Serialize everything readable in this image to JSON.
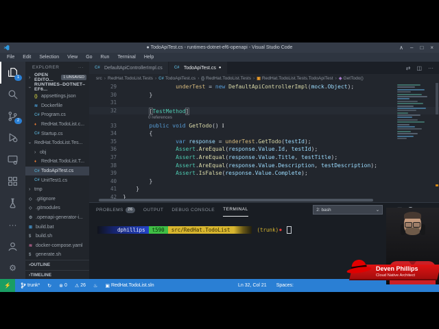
{
  "window": {
    "title": "● TodoApiTest.cs - runtimes-dotnet-ef6-openapi - Visual Studio Code",
    "controls": [
      "∧",
      "–",
      "□",
      "×"
    ]
  },
  "menu": {
    "items": [
      "File",
      "Edit",
      "Selection",
      "View",
      "Go",
      "Run",
      "Terminal",
      "Help"
    ]
  },
  "activity_bar": {
    "items": [
      {
        "name": "explorer",
        "badge": "1",
        "active": true
      },
      {
        "name": "search"
      },
      {
        "name": "source-control",
        "badge": "2"
      },
      {
        "name": "run-debug"
      },
      {
        "name": "remote-explorer"
      },
      {
        "name": "extensions"
      },
      {
        "name": "testing"
      },
      {
        "name": "more",
        "glyph": "···"
      },
      {
        "name": "account"
      },
      {
        "name": "settings",
        "glyph": "⚙"
      }
    ]
  },
  "sidebar": {
    "title": "EXPLORER",
    "title_actions": "···",
    "open_editors": {
      "label": "OPEN EDITO...",
      "badge": "1 UNSAVED"
    },
    "root": {
      "label": "RUNTIMES–DOTNET–EF6..."
    },
    "tree": [
      {
        "label": "appsettings.json",
        "icon": "json",
        "level": 1
      },
      {
        "label": "Dockerfile",
        "icon": "docker",
        "level": 1
      },
      {
        "label": "Program.cs",
        "icon": "cs",
        "level": 1
      },
      {
        "label": "RedHat.TodoList.c...",
        "icon": "flame",
        "level": 1
      },
      {
        "label": "Startup.cs",
        "icon": "cs",
        "level": 1
      },
      {
        "label": "RedHat.TodoList.Tes...",
        "level": 0,
        "chevron": "down"
      },
      {
        "label": "obj",
        "level": 1,
        "chevron": "right"
      },
      {
        "label": "RedHat.TodoList.T...",
        "icon": "flame",
        "level": 1
      },
      {
        "label": "TodoApiTest.cs",
        "icon": "cs",
        "level": 1,
        "selected": true
      },
      {
        "label": "UnitTest1.cs",
        "icon": "cs",
        "level": 1
      },
      {
        "label": "tmp",
        "level": 0,
        "chevron": "right"
      },
      {
        "label": ".gitignore",
        "icon": "diamond",
        "level": 0
      },
      {
        "label": ".gitmodules",
        "icon": "diamond",
        "level": 0
      },
      {
        "label": ".openapi-generator-i...",
        "icon": "gear",
        "level": 0
      },
      {
        "label": "build.bat",
        "icon": "win",
        "level": 0
      },
      {
        "label": "build.sh",
        "icon": "shell",
        "level": 0
      },
      {
        "label": "docker-compose.yaml",
        "icon": "compose",
        "level": 0
      },
      {
        "label": "generate.sh",
        "icon": "shell",
        "level": 0
      }
    ],
    "sections": [
      {
        "label": "OUTLINE"
      },
      {
        "label": "TIMELINE"
      }
    ]
  },
  "editor": {
    "tabs": [
      {
        "label": "DefaultApiControllerImpl.cs",
        "icon": "cs",
        "active": false,
        "dirty": false
      },
      {
        "label": "TodoApiTest.cs",
        "icon": "cs",
        "active": true,
        "dirty": true
      }
    ],
    "actions": [
      {
        "name": "open-changes",
        "glyph": "⇄"
      },
      {
        "name": "split-editor",
        "glyph": "◫"
      },
      {
        "name": "more-actions",
        "glyph": "···"
      }
    ],
    "breadcrumb": [
      {
        "label": "src"
      },
      {
        "label": "RedHat.TodoList.Tests"
      },
      {
        "label": "TodoApiTest.cs",
        "icon": "cs"
      },
      {
        "label": "RedHat.TodoList.Tests",
        "icon": "braces"
      },
      {
        "label": "RedHat.TodoList.Tests.TodoApiTest",
        "icon": "class"
      },
      {
        "label": "GetTodo()",
        "icon": "method"
      }
    ],
    "codelens": "0 references",
    "code_lines": [
      {
        "n": "29",
        "tokens": [
          [
            "                ",
            "pln"
          ],
          [
            "underTest",
            "field"
          ],
          [
            " = ",
            "pln"
          ],
          [
            "new",
            "kw"
          ],
          [
            " ",
            "pln"
          ],
          [
            "DefaultApiControllerImpl",
            "method"
          ],
          [
            "(",
            "pln"
          ],
          [
            "mock",
            "var"
          ],
          [
            ".",
            "pln"
          ],
          [
            "Object",
            "var"
          ],
          [
            ");",
            "pln"
          ]
        ]
      },
      {
        "n": "30",
        "tokens": [
          [
            "        ",
            "pln"
          ],
          [
            "}",
            "pln"
          ]
        ]
      },
      {
        "n": "31",
        "tokens": []
      },
      {
        "n": "32",
        "current": true,
        "cursor": true,
        "tokens": [
          [
            "        ",
            "pln"
          ],
          [
            "[",
            "bracket"
          ],
          [
            "TestMethod",
            "type"
          ],
          [
            "]",
            "bracket"
          ]
        ]
      },
      {
        "n": "",
        "codelens": true
      },
      {
        "n": "33",
        "ibeam": true,
        "tokens": [
          [
            "        ",
            "pln"
          ],
          [
            "public",
            "kw"
          ],
          [
            " ",
            "pln"
          ],
          [
            "void",
            "kw"
          ],
          [
            " ",
            "pln"
          ],
          [
            "GetTodo",
            "method"
          ],
          [
            "()",
            "pln"
          ]
        ]
      },
      {
        "n": "34",
        "tokens": [
          [
            "        ",
            "pln"
          ],
          [
            "{",
            "pln"
          ]
        ]
      },
      {
        "n": "35",
        "tokens": [
          [
            "                ",
            "pln"
          ],
          [
            "var",
            "kw"
          ],
          [
            " ",
            "pln"
          ],
          [
            "response",
            "var"
          ],
          [
            " = ",
            "pln"
          ],
          [
            "underTest",
            "field"
          ],
          [
            ".",
            "pln"
          ],
          [
            "GetTodo",
            "method"
          ],
          [
            "(",
            "pln"
          ],
          [
            "testId",
            "var"
          ],
          [
            ");",
            "pln"
          ]
        ]
      },
      {
        "n": "36",
        "tokens": [
          [
            "                ",
            "pln"
          ],
          [
            "Assert",
            "type"
          ],
          [
            ".",
            "pln"
          ],
          [
            "AreEqual",
            "method"
          ],
          [
            "(",
            "pln"
          ],
          [
            "response",
            "var"
          ],
          [
            ".",
            "pln"
          ],
          [
            "Value",
            "var"
          ],
          [
            ".",
            "pln"
          ],
          [
            "Id",
            "var"
          ],
          [
            ", ",
            "pln"
          ],
          [
            "testId",
            "var"
          ],
          [
            ");",
            "pln"
          ]
        ]
      },
      {
        "n": "37",
        "tokens": [
          [
            "                ",
            "pln"
          ],
          [
            "Assert",
            "type"
          ],
          [
            ".",
            "pln"
          ],
          [
            "AreEqual",
            "method"
          ],
          [
            "(",
            "pln"
          ],
          [
            "response",
            "var"
          ],
          [
            ".",
            "pln"
          ],
          [
            "Value",
            "var"
          ],
          [
            ".",
            "pln"
          ],
          [
            "Title",
            "var"
          ],
          [
            ", ",
            "pln"
          ],
          [
            "testTitle",
            "var"
          ],
          [
            ");",
            "pln"
          ]
        ]
      },
      {
        "n": "38",
        "tokens": [
          [
            "                ",
            "pln"
          ],
          [
            "Assert",
            "type"
          ],
          [
            ".",
            "pln"
          ],
          [
            "AreEqual",
            "method"
          ],
          [
            "(",
            "pln"
          ],
          [
            "response",
            "var"
          ],
          [
            ".",
            "pln"
          ],
          [
            "Value",
            "var"
          ],
          [
            ".",
            "pln"
          ],
          [
            "Description",
            "var"
          ],
          [
            ", ",
            "pln"
          ],
          [
            "testDescription",
            "var"
          ],
          [
            ");",
            "pln"
          ]
        ]
      },
      {
        "n": "39",
        "tokens": [
          [
            "                ",
            "pln"
          ],
          [
            "Assert",
            "type"
          ],
          [
            ".",
            "pln"
          ],
          [
            "IsFalse",
            "method"
          ],
          [
            "(",
            "pln"
          ],
          [
            "response",
            "var"
          ],
          [
            ".",
            "pln"
          ],
          [
            "Value",
            "var"
          ],
          [
            ".",
            "pln"
          ],
          [
            "Complete",
            "var"
          ],
          [
            ");",
            "pln"
          ]
        ]
      },
      {
        "n": "40",
        "tokens": [
          [
            "        ",
            "pln"
          ],
          [
            "}",
            "pln"
          ]
        ]
      },
      {
        "n": "41",
        "tokens": [
          [
            "    ",
            "pln"
          ],
          [
            "}",
            "pln"
          ]
        ]
      },
      {
        "n": "42",
        "tokens": [
          [
            "}",
            "pln"
          ]
        ]
      }
    ],
    "minimap_widths": [
      34,
      26,
      40,
      20,
      36,
      44,
      18,
      30,
      38,
      24,
      42,
      28,
      16,
      34,
      22,
      30,
      40,
      18,
      26,
      36,
      20,
      30,
      24,
      14
    ]
  },
  "panel": {
    "tabs": [
      {
        "label": "PROBLEMS",
        "badge": "26"
      },
      {
        "label": "OUTPUT"
      },
      {
        "label": "DEBUG CONSOLE"
      },
      {
        "label": "TERMINAL",
        "active": true
      }
    ],
    "shell_select": "2: bash",
    "shell_chevron": "⌄",
    "actions": [
      {
        "name": "new-terminal",
        "glyph": "+"
      },
      {
        "name": "split-terminal",
        "glyph": "◫"
      },
      {
        "name": "kill-terminal",
        "glyph": "trash"
      },
      {
        "name": "maximize-panel",
        "glyph": "∧"
      },
      {
        "name": "close-panel",
        "glyph": "×"
      }
    ],
    "terminal": {
      "segments": [
        {
          "text": "dphillips",
          "style": "user"
        },
        {
          "text": "t590",
          "style": "host"
        },
        {
          "text": "src/RedHat.TodoList",
          "style": "path"
        }
      ],
      "suffix": "(trunk)",
      "dot": "●"
    }
  },
  "status_bar": {
    "remote_glyph": "⚡",
    "left": [
      {
        "name": "git-branch",
        "icon": "branch",
        "text": "trunk*"
      },
      {
        "name": "sync",
        "glyph": "↻",
        "text": ""
      },
      {
        "name": "errors",
        "glyph": "⊗",
        "text": "0"
      },
      {
        "name": "warnings",
        "glyph": "⚠",
        "text": "26"
      },
      {
        "name": "flame",
        "glyph": "♨",
        "text": ""
      },
      {
        "name": "solution",
        "glyph": "▣",
        "text": "RedHat.TodoList.sln"
      }
    ],
    "right": [
      {
        "name": "cursor-position",
        "text": "Ln 32, Col 21"
      },
      {
        "name": "indentation",
        "text": "Spaces:"
      }
    ]
  },
  "webcam": {
    "name": "Deven Phillips",
    "title": "Cloud Native Architect"
  },
  "colors": {
    "status_blue": "#2a7fd4",
    "remote_green": "#1a9e63",
    "editor_bg": "#22262d",
    "banner_red": "#d40f0f",
    "prompt_blue": "#2343c7",
    "prompt_green": "#3fbf45",
    "prompt_yellow": "#d8b62f"
  }
}
